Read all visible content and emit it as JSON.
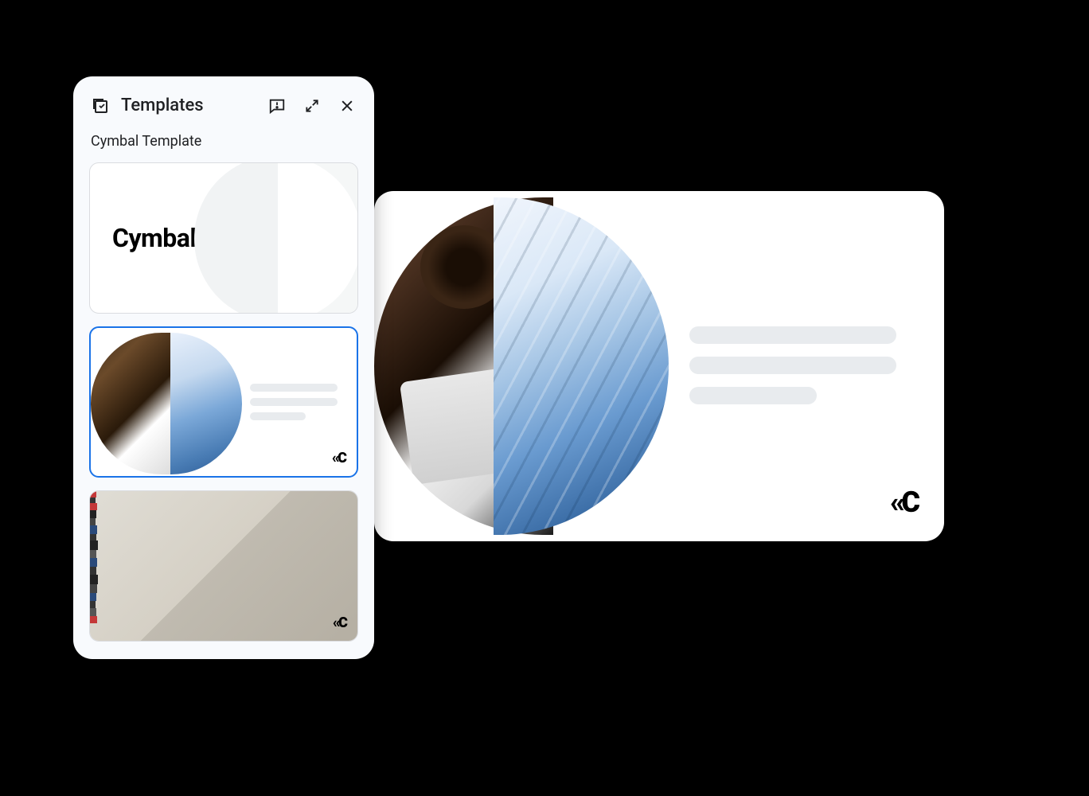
{
  "panel": {
    "title": "Templates",
    "subtitle": "Cymbal Template",
    "icons": {
      "templates": "templates-icon",
      "feedback": "feedback-icon",
      "expand": "expand-icon",
      "close": "close-icon"
    }
  },
  "templates": [
    {
      "id": "cymbal-title",
      "brand_text": "Cymbal",
      "selected": false
    },
    {
      "id": "cymbal-photo-split",
      "logo_mark": "‹‹C",
      "selected": true
    },
    {
      "id": "cymbal-aerial",
      "logo_mark": "‹‹C",
      "selected": false
    }
  ],
  "preview": {
    "logo_mark": "‹‹C",
    "lines": [
      260,
      260,
      160
    ]
  },
  "colors": {
    "selection": "#1a73e8",
    "panel_bg": "#f8fafd",
    "placeholder": "#e8ebee"
  }
}
